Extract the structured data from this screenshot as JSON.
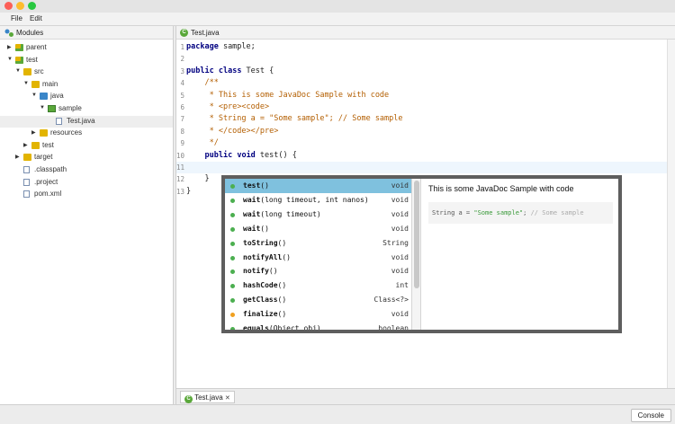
{
  "menu": [
    "File",
    "Edit"
  ],
  "sidebar": {
    "title": "Modules",
    "tree": [
      {
        "label": "parent",
        "type": "module",
        "arrow": "▶",
        "indent": 0
      },
      {
        "label": "test",
        "type": "module",
        "arrow": "▼",
        "indent": 0
      },
      {
        "label": "src",
        "type": "folder",
        "arrow": "▼",
        "indent": 1
      },
      {
        "label": "main",
        "type": "folder",
        "arrow": "▼",
        "indent": 2
      },
      {
        "label": "java",
        "type": "folder-blue",
        "arrow": "▼",
        "indent": 3
      },
      {
        "label": "sample",
        "type": "package",
        "arrow": "▼",
        "indent": 4
      },
      {
        "label": "Test.java",
        "type": "file",
        "arrow": "",
        "indent": 5
      },
      {
        "label": "resources",
        "type": "folder",
        "arrow": "▶",
        "indent": 3
      },
      {
        "label": "test",
        "type": "folder",
        "arrow": "▶",
        "indent": 2
      },
      {
        "label": "target",
        "type": "folder",
        "arrow": "▶",
        "indent": 1
      },
      {
        "label": ".classpath",
        "type": "file",
        "arrow": "",
        "indent": 1
      },
      {
        "label": ".project",
        "type": "file",
        "arrow": "",
        "indent": 1
      },
      {
        "label": "pom.xml",
        "type": "file",
        "arrow": "",
        "indent": 1
      }
    ],
    "selected_index": 6
  },
  "editor": {
    "tab_label": "Test.java",
    "bottom_tab_label": "Test.java",
    "bottom_tab_close": "✕",
    "lines": [
      {
        "n": "1",
        "parts": [
          [
            "kw",
            "package"
          ],
          [
            "",
            " sample;"
          ]
        ]
      },
      {
        "n": "2",
        "parts": []
      },
      {
        "n": "3",
        "parts": [
          [
            "kw",
            "public"
          ],
          [
            "",
            " "
          ],
          [
            "kw",
            "class"
          ],
          [
            "",
            " Test {"
          ]
        ]
      },
      {
        "n": "4",
        "parts": [
          [
            "cm",
            "    /**"
          ]
        ]
      },
      {
        "n": "5",
        "parts": [
          [
            "cm",
            "     * This is some JavaDoc Sample with code"
          ]
        ]
      },
      {
        "n": "6",
        "parts": [
          [
            "cm",
            "     * <pre><code>"
          ]
        ]
      },
      {
        "n": "7",
        "parts": [
          [
            "cm",
            "     * String a = \"Some sample\"; // Some sample"
          ]
        ]
      },
      {
        "n": "8",
        "parts": [
          [
            "cm",
            "     * </code></pre>"
          ]
        ]
      },
      {
        "n": "9",
        "parts": [
          [
            "cm",
            "     */"
          ]
        ]
      },
      {
        "n": "10",
        "parts": [
          [
            "",
            "    "
          ],
          [
            "kw",
            "public"
          ],
          [
            "",
            " "
          ],
          [
            "kw",
            "void"
          ],
          [
            "",
            " test() {"
          ]
        ]
      },
      {
        "n": "11",
        "parts": []
      },
      {
        "n": "12",
        "parts": [
          [
            "",
            "    }"
          ]
        ]
      },
      {
        "n": "13",
        "parts": [
          [
            "",
            "}"
          ]
        ]
      }
    ],
    "current_line": 11
  },
  "completion": {
    "items": [
      {
        "name": "test",
        "args": "()",
        "ret": "void",
        "color": "#4caf50"
      },
      {
        "name": "wait",
        "args": "(long timeout, int nanos)",
        "ret": "void",
        "color": "#4caf50"
      },
      {
        "name": "wait",
        "args": "(long timeout)",
        "ret": "void",
        "color": "#4caf50"
      },
      {
        "name": "wait",
        "args": "()",
        "ret": "void",
        "color": "#4caf50"
      },
      {
        "name": "toString",
        "args": "()",
        "ret": "String",
        "color": "#4caf50"
      },
      {
        "name": "notifyAll",
        "args": "()",
        "ret": "void",
        "color": "#4caf50"
      },
      {
        "name": "notify",
        "args": "()",
        "ret": "void",
        "color": "#4caf50"
      },
      {
        "name": "hashCode",
        "args": "()",
        "ret": "int",
        "color": "#4caf50"
      },
      {
        "name": "getClass",
        "args": "()",
        "ret": "Class<?>",
        "color": "#4caf50"
      },
      {
        "name": "finalize",
        "args": "()",
        "ret": "void",
        "color": "#f0a020"
      },
      {
        "name": "equals",
        "args": "(Object obj)",
        "ret": "boolean",
        "color": "#4caf50"
      }
    ],
    "selected_index": 0,
    "doc_title": "This is some JavaDoc Sample with code",
    "doc_code": "String a = ",
    "doc_string": "\"Some sample\"",
    "doc_semicolon": "; ",
    "doc_comment": "// Some sample"
  },
  "status": {
    "console_label": "Console"
  },
  "colors": {
    "selection": "#7fc1de",
    "keyword": "#000080",
    "comment": "#b35e00",
    "string": "#3a9a3a"
  }
}
